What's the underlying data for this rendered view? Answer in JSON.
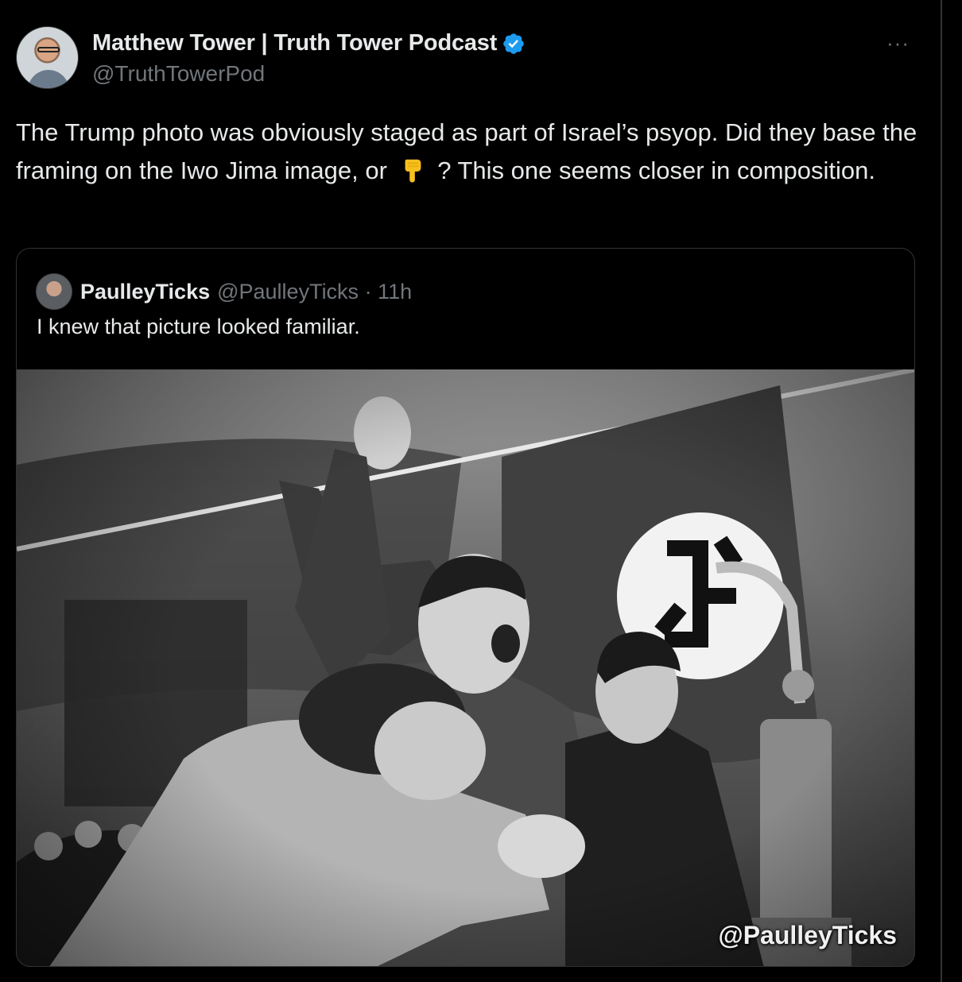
{
  "author": {
    "display_name": "Matthew Tower | Truth Tower Podcast",
    "handle": "@TruthTowerPod",
    "verified_icon": "verified-badge-icon",
    "avatar_icon": "profile-avatar"
  },
  "more_label": "···",
  "tweet": {
    "text_part1": "The Trump photo was obviously staged as part of Israel’s psyop. Did they base the framing on the Iwo Jima image, or",
    "emoji_icon": "backhand-index-pointing-down-icon",
    "text_part2": "? This one seems closer in composition."
  },
  "quote": {
    "name": "PaulleyTicks",
    "handle_time": "@PaulleyTicks · 11h",
    "text": "I knew that picture looked familiar.",
    "image_watermark": "@PaulleyTicks",
    "image_icon": "composite-photo"
  },
  "colors": {
    "background": "#000000",
    "text": "#e7e9ea",
    "secondary": "#71767b",
    "border": "#2f3336",
    "verified": "#1d9bf0"
  }
}
